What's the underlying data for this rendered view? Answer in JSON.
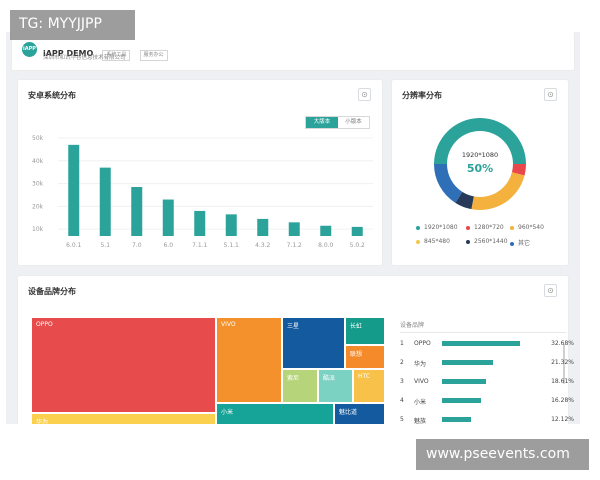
{
  "overlays": {
    "top_label": "TG: MYYJJPP",
    "bottom_label": "www.pseevents.com"
  },
  "header": {
    "app_name": "iAPP DEMO",
    "logo_text": "iAPP",
    "tag1": "系统工具",
    "tag2": "服务办公",
    "company": "深圳市和讯华谷信息技术有限公司"
  },
  "android_card": {
    "title": "安卓系统分布",
    "toggle_active": "大版本",
    "toggle_inactive": "小版本"
  },
  "resolution_card": {
    "title": "分辨率分布",
    "center_label": "1920*1080",
    "center_value": "50%",
    "legend": [
      {
        "label": "1920*1080",
        "color": "#2ba39a"
      },
      {
        "label": "1280*720",
        "color": "#e8474c"
      },
      {
        "label": "960*540",
        "color": "#f5b13d"
      },
      {
        "label": "845*480",
        "color": "#f3c64c"
      },
      {
        "label": "2560*1440",
        "color": "#283a59"
      },
      {
        "label": "其它",
        "color": "#2e6fb7"
      }
    ]
  },
  "brand_card": {
    "title": "设备品牌分布",
    "panel_title": "设备品牌",
    "treemap": [
      {
        "label": "OPPO",
        "color": "#e84b4b"
      },
      {
        "label": "VIVO",
        "color": "#f5912d"
      },
      {
        "label": "三星",
        "color": "#135a9e"
      },
      {
        "label": "长虹",
        "color": "#149b89"
      },
      {
        "label": "联想",
        "color": "#f48a2a"
      },
      {
        "label": "索尼",
        "color": "#b6d57b"
      },
      {
        "label": "酷派",
        "color": "#7bd1c2"
      },
      {
        "label": "HTC",
        "color": "#f8c24a"
      },
      {
        "label": "小米",
        "color": "#16a398"
      },
      {
        "label": "魅比道",
        "color": "#135a9e"
      },
      {
        "label": "华为",
        "color": "#fbd04f"
      }
    ],
    "ranking": [
      {
        "rank": "1",
        "name": "OPPO",
        "pct": "32.68%",
        "value": 32.68
      },
      {
        "rank": "2",
        "name": "华为",
        "pct": "21.32%",
        "value": 21.32
      },
      {
        "rank": "3",
        "name": "VIVO",
        "pct": "18.61%",
        "value": 18.61
      },
      {
        "rank": "4",
        "name": "小米",
        "pct": "16.28%",
        "value": 16.28
      },
      {
        "rank": "5",
        "name": "魅族",
        "pct": "12.12%",
        "value": 12.12
      }
    ]
  },
  "chart_data": [
    {
      "type": "bar",
      "title": "安卓系统分布",
      "categories": [
        "6.0.1",
        "5.1",
        "7.0",
        "6.0",
        "7.1.1",
        "5.1.1",
        "4.3.2",
        "7.1.2",
        "8.0.0",
        "5.0.2"
      ],
      "values": [
        47000,
        37000,
        28500,
        23000,
        18000,
        16500,
        14500,
        13000,
        11500,
        11000
      ],
      "yticks": [
        "50k",
        "40k",
        "30k",
        "20k",
        "10k"
      ],
      "ylim": [
        7000,
        50000
      ],
      "color": "#2ba39a"
    },
    {
      "type": "pie",
      "title": "分辨率分布",
      "labels": [
        "1920*1080",
        "1280*720",
        "960*540",
        "845*480",
        "2560*1440",
        "其它"
      ],
      "values": [
        50,
        4,
        24,
        0,
        6,
        16
      ],
      "colors": [
        "#2ba39a",
        "#e8474c",
        "#f5b13d",
        "#f3c64c",
        "#283a59",
        "#2e6fb7"
      ]
    }
  ]
}
